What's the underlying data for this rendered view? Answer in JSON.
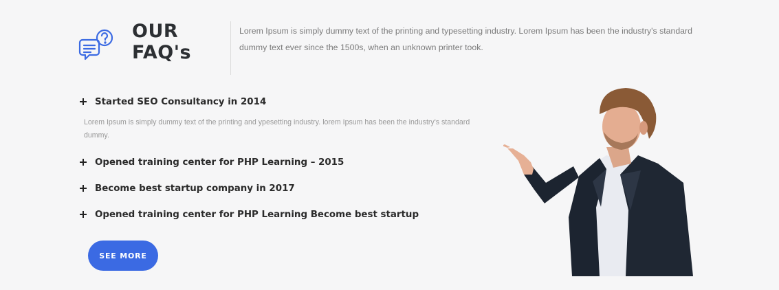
{
  "header": {
    "title_line1": "OUR",
    "title_line2": "FAQ's",
    "icon": "faq-chat-icon",
    "intro": "Lorem Ipsum is simply dummy text of the printing and typesetting industry. Lorem Ipsum has been the industry's standard dummy text ever since the 1500s, when an unknown printer took."
  },
  "faq": {
    "items": [
      {
        "question": "Started SEO Consultancy in 2014",
        "answer": "Lorem Ipsum is simply dummy text of the printing and ypesetting industry. lorem Ipsum has been the industry's standard dummy.",
        "expanded": true
      },
      {
        "question": "Opened training center for PHP Learning – 2015",
        "expanded": false
      },
      {
        "question": "Become best startup company in 2017",
        "expanded": false
      },
      {
        "question": "Opened training center for PHP Learning Become best startup",
        "expanded": false
      }
    ]
  },
  "cta": {
    "label": "SEE MORE"
  },
  "colors": {
    "accent": "#3b6ae3",
    "background": "#f6f6f7",
    "heading": "#2c2f33",
    "body_text": "#7a7a7a"
  }
}
